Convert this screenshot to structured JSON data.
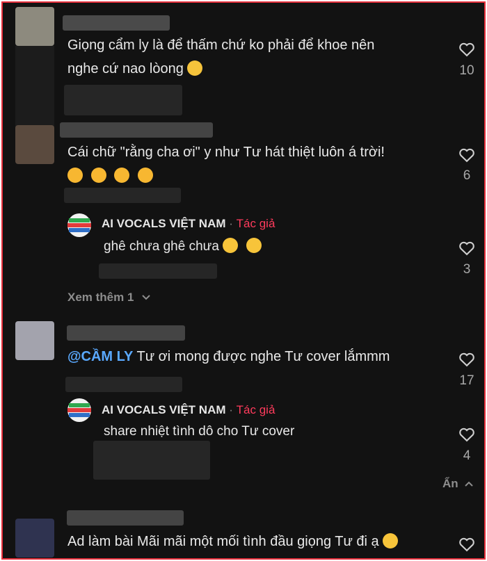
{
  "comments": [
    {
      "text_line1": "Giọng cẩm ly là để thấm chứ ko phải để khoe nên",
      "text_line2": "nghe cứ nao lòong",
      "likes": "10"
    },
    {
      "text_line1": "Cái chữ \"rằng cha ơi\" y như Tư hát thiệt luôn á trời!",
      "likes": "6",
      "replies": [
        {
          "author": "AI VOCALS VIỆT NAM",
          "separator": "·",
          "badge": "Tác giả",
          "text": "ghê chưa ghê chưa",
          "likes": "3"
        }
      ],
      "view_more": "Xem thêm 1"
    },
    {
      "mention": "@CẦM LY",
      "text": " Tư ơi mong được nghe Tư cover lắmmm",
      "likes": "17",
      "replies": [
        {
          "author": "AI VOCALS VIỆT NAM",
          "separator": "·",
          "badge": "Tác giả",
          "text": "share nhiệt tình dô cho Tư cover",
          "likes": "4"
        }
      ],
      "hide": "Ẩn"
    },
    {
      "text": "Ad làm bài Mãi mãi một mối tình đầu giọng Tư đi ạ"
    }
  ],
  "icons": {
    "like": "heart-outline-icon",
    "expand": "chevron-down-icon",
    "collapse": "chevron-up-icon"
  },
  "colors": {
    "background": "#121212",
    "author_badge": "#ff3b5c",
    "mention": "#5aa9ff",
    "frame": "#e8303c"
  }
}
